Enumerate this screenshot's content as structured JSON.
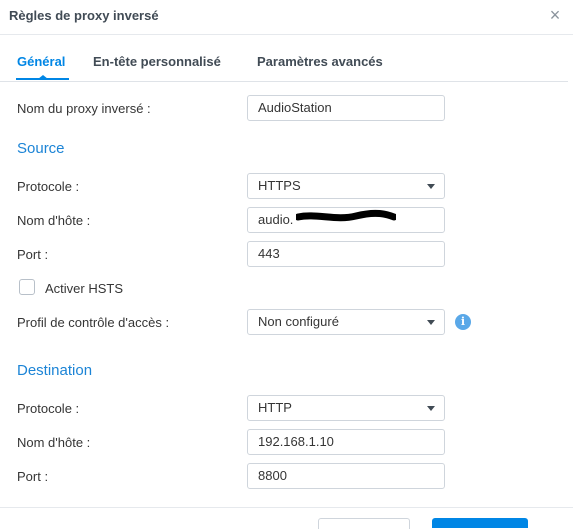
{
  "dialog": {
    "title": "Règles de proxy inversé",
    "close_glyph": "×"
  },
  "tabs": [
    {
      "label": "Général",
      "active": true
    },
    {
      "label": "En-tête personnalisé",
      "active": false
    },
    {
      "label": "Paramètres avancés",
      "active": false
    }
  ],
  "proxy_name": {
    "label": "Nom du proxy inversé :",
    "value": "AudioStation"
  },
  "source": {
    "heading": "Source",
    "protocol": {
      "label": "Protocole :",
      "value": "HTTPS"
    },
    "hostname": {
      "label": "Nom d'hôte :",
      "value": "audio."
    },
    "port": {
      "label": "Port :",
      "value": "443"
    },
    "hsts": {
      "label": "Activer HSTS",
      "checked": false
    },
    "access_profile": {
      "label": "Profil de contrôle d'accès :",
      "value": "Non configuré"
    }
  },
  "destination": {
    "heading": "Destination",
    "protocol": {
      "label": "Protocole :",
      "value": "HTTP"
    },
    "hostname": {
      "label": "Nom d'hôte :",
      "value": "192.168.1.10"
    },
    "port": {
      "label": "Port :",
      "value": "8800"
    }
  },
  "colors": {
    "accent": "#0086e5",
    "section_heading": "#1c84d6",
    "border": "#cfd5dc"
  }
}
